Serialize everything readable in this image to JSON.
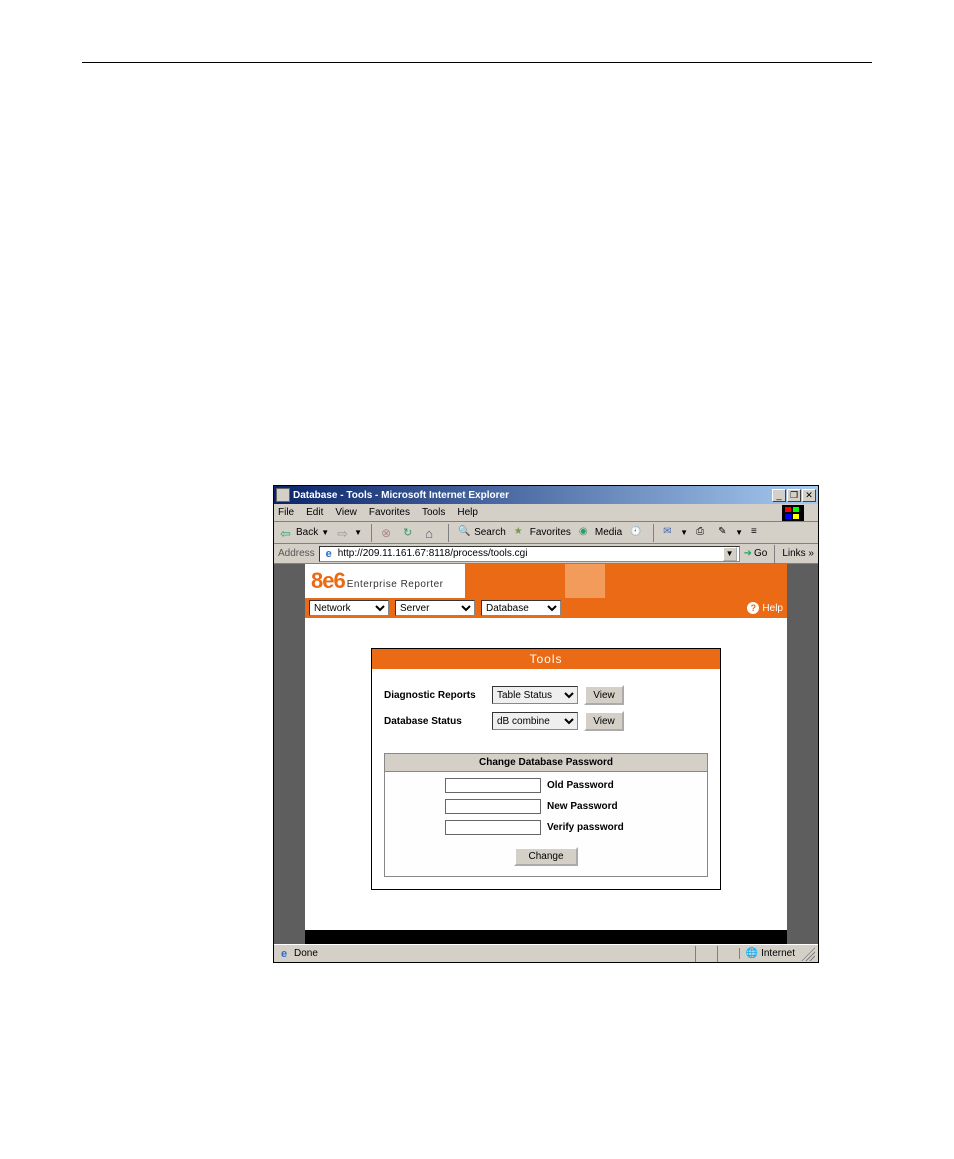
{
  "window": {
    "title": "Database - Tools - Microsoft Internet Explorer",
    "min": "_",
    "max": "❐",
    "close": "✕"
  },
  "menus": {
    "file": "File",
    "edit": "Edit",
    "view": "View",
    "favorites": "Favorites",
    "tools": "Tools",
    "help": "Help"
  },
  "toolbar": {
    "back": "Back",
    "search": "Search",
    "favorites": "Favorites",
    "media": "Media"
  },
  "address": {
    "label": "Address",
    "url": "http://209.11.161.67:8118/process/tools.cgi",
    "go": "Go",
    "links": "Links »"
  },
  "app": {
    "brand_prefix": "8e6",
    "brand_suffix": "Enterprise Reporter",
    "nav": {
      "network": "Network",
      "server": "Server",
      "database": "Database"
    },
    "help": "Help"
  },
  "panel": {
    "title": "Tools",
    "diag_label": "Diagnostic Reports",
    "diag_option": "Table Status",
    "dbstat_label": "Database Status",
    "dbstat_option": "dB combine",
    "view": "View",
    "pw_title": "Change Database Password",
    "old": "Old Password",
    "newp": "New Password",
    "verify": "Verify password",
    "change": "Change"
  },
  "status": {
    "done": "Done",
    "zone": "Internet"
  }
}
